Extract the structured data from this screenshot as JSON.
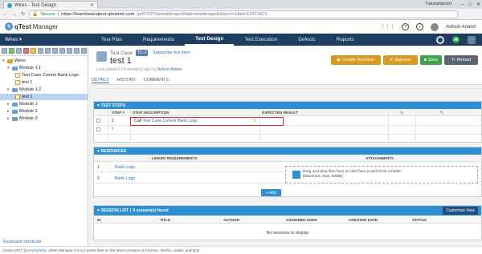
{
  "browser": {
    "tab_title": "Wires - Test Design",
    "user": "Tutorialspoint",
    "secure_label": "Secure",
    "url_host": "https://learnbasicqtest.qtestnet.com",
    "url_path": "/p/47327/portal/project#tab=testdesign&object=1&id=12473971"
  },
  "app": {
    "logo_letter": "q",
    "name_bold": "qTest",
    "name_rest": "Manager",
    "user_name": "Ashish Anand",
    "notification_count": "38"
  },
  "nav": {
    "project": "Wires ▾",
    "tabs": [
      {
        "label": "Test Plan"
      },
      {
        "label": "Requirements"
      },
      {
        "label": "Test Design"
      },
      {
        "label": "Test Execution"
      },
      {
        "label": "Defects"
      },
      {
        "label": "Reports"
      }
    ]
  },
  "tree": {
    "nodes": [
      {
        "label": "Wires",
        "toggle": "▾"
      },
      {
        "label": "Module 1.1",
        "toggle": "▾"
      },
      {
        "label": "Test Case Covers Bank Logo",
        "toggle": ""
      },
      {
        "label": "test 1",
        "toggle": ""
      },
      {
        "label": "Module 1.2",
        "toggle": "▾"
      },
      {
        "label": "test 1",
        "toggle": ""
      },
      {
        "label": "Module 1",
        "toggle": "▸"
      },
      {
        "label": "Module 2",
        "toggle": "▸"
      },
      {
        "label": "Module 3",
        "toggle": "▸"
      }
    ],
    "keyboard_shortcuts": "Keyboard shortcuts"
  },
  "details": {
    "type_label": "Test Case",
    "id_badge": "TC-3",
    "subscribe": "Subscribe this item",
    "title": "test 1",
    "updated_prefix": "Last updated 14 minute(s) ago by",
    "updated_by": "Ashish Anand",
    "buttons": {
      "create": "Create Test Run",
      "approve": "Approve",
      "save": "Save",
      "reload": "Reload"
    },
    "tabs": [
      "DETAILS",
      "HISTORY",
      "COMMENTS"
    ]
  },
  "test_steps": {
    "header": "TEST STEPS",
    "columns": [
      "STEP #",
      "STEP DESCRIPTION",
      "EXPECTED RESULT"
    ],
    "rows": [
      {
        "num": "1",
        "desc_prefix": "Call",
        "desc_link": "Test Case Covers Bank Logo"
      },
      {
        "num": "*",
        "desc_prefix": "",
        "desc_link": ""
      }
    ]
  },
  "resources": {
    "header": "RESOURCES",
    "linked_header": "LINKED REQUIREMENTS",
    "attachments_header": "ATTACHMENTS",
    "rows": [
      {
        "num": "1",
        "name": "Bank Logo"
      },
      {
        "num": "2",
        "name": "Bank Logo"
      }
    ],
    "drop_text_1": "Drag and drop files here or click here to pick from a folder",
    "drop_text_2": "(Maximum Size: 50MB)",
    "add_button": "+ Add"
  },
  "session": {
    "header": "SESSION LIST",
    "found": "0 session(s) found",
    "customize": "Customize View",
    "columns": [
      "ID",
      "TITLE",
      "AUTHOR",
      "ASSIGNED USER",
      "CREATED DATE",
      "STATUS"
    ],
    "empty": "No sessions to display"
  },
  "footer": {
    "copyright": "©2010-2017",
    "company": "QASymphony",
    "text": ". qTest Manager 8.5.3.2 works best on the latest versions of Chrome, Firefox, Safari, and IE11."
  }
}
